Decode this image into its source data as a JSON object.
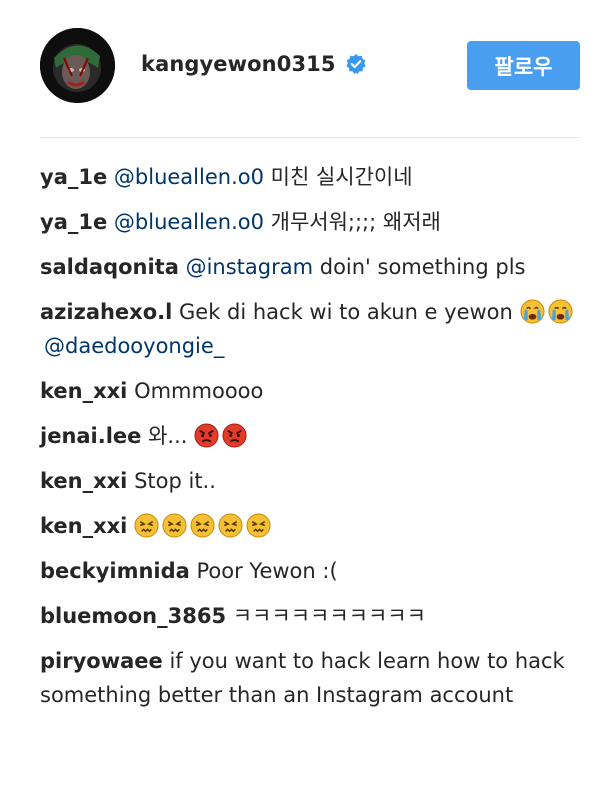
{
  "header": {
    "username": "kangyewon0315",
    "follow_label": "팔로우",
    "accent_color": "#4a9ef0",
    "verified_icon": "verified-badge-icon"
  },
  "comments": [
    {
      "author": "ya_1e",
      "mention": "@blueallen.o0",
      "text": " 미친 실시간이네"
    },
    {
      "author": "ya_1e",
      "mention": "@blueallen.o0",
      "text": " 개무서워;;;; 왜저래"
    },
    {
      "author": "saldaqonita",
      "mention": "@instagram",
      "text": " doin' something pls"
    },
    {
      "author": "azizahexo.l",
      "text": " Gek di hack wi to akun e yewon ",
      "emojis": [
        "crying-face-emoji",
        "crying-face-emoji"
      ],
      "mention_after": "@daedooyongie_"
    },
    {
      "author": "ken_xxi",
      "text": " Ommmoooo"
    },
    {
      "author": "jenai.lee",
      "text": " 와... ",
      "emojis": [
        "angry-face-emoji",
        "angry-face-emoji"
      ]
    },
    {
      "author": "ken_xxi",
      "text": " Stop it.."
    },
    {
      "author": "ken_xxi",
      "text": " ",
      "emojis": [
        "persevering-face-emoji",
        "persevering-face-emoji",
        "persevering-face-emoji",
        "persevering-face-emoji",
        "persevering-face-emoji"
      ]
    },
    {
      "author": "beckyimnida",
      "text": " Poor Yewon :("
    },
    {
      "author": "bluemoon_3865",
      "text": " ㅋㅋㅋㅋㅋㅋㅋㅋㅋㅋ"
    },
    {
      "author": "piryowaee",
      "text": " if you want to hack learn how to hack something better than an Instagram account"
    }
  ]
}
